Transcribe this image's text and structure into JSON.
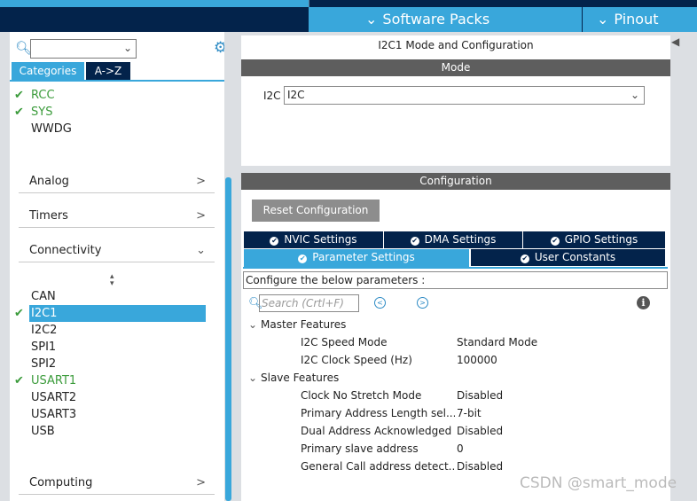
{
  "topbar": {
    "software_packs": "Software Packs",
    "pinout": "Pinout"
  },
  "left": {
    "search": {
      "value": ""
    },
    "tabs": {
      "categories": "Categories",
      "az": "A->Z"
    },
    "system_items": [
      {
        "label": "RCC",
        "checked": true
      },
      {
        "label": "SYS",
        "checked": true
      },
      {
        "label": "WWDG",
        "checked": false
      }
    ],
    "categories": {
      "analog": "Analog",
      "timers": "Timers",
      "connectivity": "Connectivity",
      "computing": "Computing"
    },
    "connectivity_items": [
      {
        "label": "CAN",
        "checked": false
      },
      {
        "label": "I2C1",
        "checked": true,
        "selected": true
      },
      {
        "label": "I2C2",
        "checked": false
      },
      {
        "label": "SPI1",
        "checked": false
      },
      {
        "label": "SPI2",
        "checked": false
      },
      {
        "label": "USART1",
        "checked": true
      },
      {
        "label": "USART2",
        "checked": false
      },
      {
        "label": "USART3",
        "checked": false
      },
      {
        "label": "USB",
        "checked": false
      }
    ]
  },
  "mode": {
    "title": "I2C1 Mode and Configuration",
    "bar": "Mode",
    "i2c_label": "I2C",
    "i2c_value": "I2C"
  },
  "configuration": {
    "bar": "Configuration",
    "reset_button": "Reset Configuration",
    "tabs": {
      "nvic": "NVIC Settings",
      "dma": "DMA Settings",
      "gpio": "GPIO Settings",
      "parameter": "Parameter Settings",
      "user_constants": "User Constants"
    },
    "description": "Configure the below parameters :",
    "search_placeholder": "Search (Crtl+F)",
    "groups": {
      "master": "Master Features",
      "slave": "Slave Features"
    },
    "master_params": [
      {
        "name": "I2C Speed Mode",
        "value": "Standard Mode"
      },
      {
        "name": "I2C Clock Speed (Hz)",
        "value": "100000"
      }
    ],
    "slave_params": [
      {
        "name": "Clock No Stretch Mode",
        "value": "Disabled"
      },
      {
        "name": "Primary Address Length sel...",
        "value": "7-bit"
      },
      {
        "name": "Dual Address Acknowledged",
        "value": "Disabled"
      },
      {
        "name": "Primary slave address",
        "value": "0"
      },
      {
        "name": "General Call address detect...",
        "value": "Disabled"
      }
    ]
  },
  "watermark": "CSDN @smart_mode",
  "colors": {
    "accent": "#39a7db",
    "navy": "#03234b",
    "check": "#3b9b3b",
    "bar": "#5e5e5e"
  }
}
